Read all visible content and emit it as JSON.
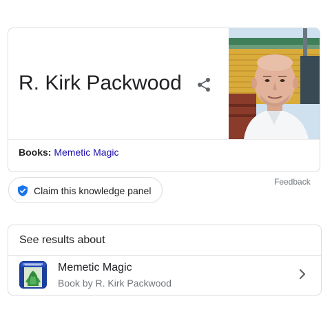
{
  "knowledge_panel": {
    "title": "R. Kirk Packwood",
    "share_icon": "share-icon",
    "photo": "person-photo",
    "facts": [
      {
        "label": "Books:",
        "value": "Memetic Magic"
      }
    ],
    "claim_label": "Claim this knowledge panel",
    "claim_icon": "verified-shield-icon",
    "feedback_label": "Feedback"
  },
  "see_results_about": {
    "heading": "See results about",
    "items": [
      {
        "title": "Memetic Magic",
        "subtitle": "Book by R. Kirk Packwood",
        "thumbnail": "book-cover-thumbnail",
        "chevron": "chevron-right-icon"
      }
    ]
  },
  "colors": {
    "link": "#1a0dab",
    "text": "#202124",
    "secondary_text": "#70757a",
    "border": "#dadce0",
    "verified_blue": "#1a73e8"
  }
}
